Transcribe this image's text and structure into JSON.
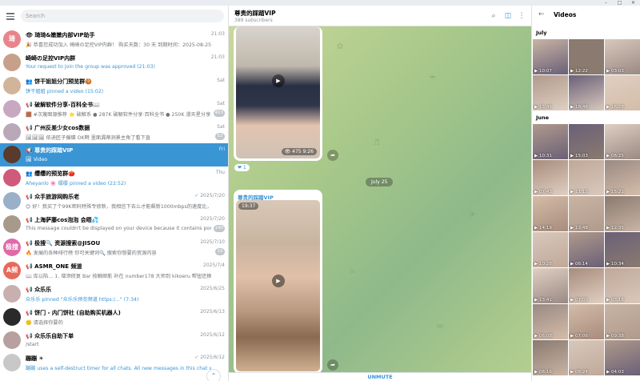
{
  "window": {
    "controls": [
      "–",
      "□",
      "✕"
    ]
  },
  "search": {
    "placeholder": "Search"
  },
  "chats": [
    {
      "name": "👁 琦琦&嫩嫩内部VIP助手",
      "time": "21:03",
      "preview": "🎉 恭喜您成功加入 崎崎の足控VIP内群！ 购买天数：30 天 到期时间：2025-08-25 21:03:53",
      "preview_style": "gray",
      "avatar_text": "琦",
      "avatar_color": "#e8848c",
      "badge": ""
    },
    {
      "name": "崎崎の足控VIP内群",
      "time": "21:03",
      "preview": "Your request to join the group was approved (21:03)",
      "preview_style": "blue",
      "avatar_text": "",
      "avatar_color": "#c7a08a",
      "badge": ""
    },
    {
      "name": "👥 饼干姐姐分门预览群🍪",
      "time": "Sat",
      "preview": "饼干姐姐 pinned a video (15:02)",
      "preview_style": "blue",
      "avatar_text": "",
      "avatar_color": "#d2b49a",
      "badge": ""
    },
    {
      "name": "📢 破解软件分享-百科全书📖",
      "time": "Sat",
      "preview": "🟫 #次蔑图源推荐 ⭐ 破解系 ● 287K 破解软件分享·百科全书 ● 250K 漫天星分享分...",
      "preview_style": "gray",
      "avatar_text": "",
      "avatar_color": "#c8a8c0",
      "badge": "403"
    },
    {
      "name": "📢 广州反差少女cos数据",
      "time": "Sat",
      "preview": "🖼🖼🖼 依迪匠子偏蝶 OK啊 里面漏蒂洞景主角了看下直",
      "preview_style": "gray",
      "avatar_text": "",
      "avatar_color": "#b8a8b8",
      "badge": "52"
    },
    {
      "name": "📢 尊贵的踩踏VIP",
      "time": "Fri",
      "preview": "🖼 Video",
      "preview_style": "gray",
      "avatar_text": "",
      "avatar_color": "#5a3a2a",
      "badge": "",
      "active": true
    },
    {
      "name": "👥 缨缨的预览群🍅",
      "time": "Thu",
      "preview": "Aheyanlo 🌸 缨缨 pinned a video (22:52)",
      "preview_style": "blue",
      "avatar_text": "",
      "avatar_color": "#d05a7a",
      "badge": ""
    },
    {
      "name": "📢 众手旅游网购乐老",
      "time": "✓ 2025/7/20",
      "preview": "😊 好！我买了个99K密码特殊专修新，我相信下去么才能飙新1000mbps的速度比，现在有我...",
      "preview_style": "gray",
      "avatar_text": "",
      "avatar_color": "#9ab0c8",
      "badge": ""
    },
    {
      "name": "📢 上海萨藤cos泡泡 会晤💦",
      "time": "2025/7/20",
      "preview": "This message couldn't be displayed on your device because it contains pornographic m...",
      "preview_style": "gray",
      "avatar_text": "",
      "avatar_color": "#a89a8a",
      "badge": "140"
    },
    {
      "name": "📢 极搜🔍 资源搜索@JISOU",
      "time": "2025/7/10",
      "preview": "🔥 发展的各种排行榜 你可关键词🔍 搜索你想要的资源内容",
      "preview_style": "gray",
      "avatar_text": "极搜",
      "avatar_color": "#e06aa8",
      "badge": "19"
    },
    {
      "name": "📢 ASMR_ONE 频道",
      "time": "2025/7/4",
      "preview": "📖 库以陷… 1. 增添修复 Bar 按触继能 补在 number178 大师到 kikoeru 帮钮还换数于。 指向...",
      "preview_style": "gray",
      "avatar_text": "A频",
      "avatar_color": "#e86a5a",
      "badge": ""
    },
    {
      "name": "📢 众乐乐",
      "time": "2025/6/25",
      "preview": "众乐乐 pinned \"众乐乐预览频道 https:/...\" (7:34)",
      "preview_style": "blue",
      "avatar_text": "",
      "avatar_color": "#c8b0b0",
      "badge": ""
    },
    {
      "name": "📢 饼门 - 内门饼社 (自助购买机器人)",
      "time": "2025/6/13",
      "preview": "🙂 请选择你要的",
      "preview_style": "gray",
      "avatar_text": "",
      "avatar_color": "#2a2a2a",
      "badge": ""
    },
    {
      "name": "📢 众乐乐自助下单",
      "time": "2025/6/12",
      "preview": "/start",
      "preview_style": "gray",
      "avatar_text": "",
      "avatar_color": "#b8a0a0",
      "badge": ""
    },
    {
      "name": "蹦蹦 ☀",
      "time": "✓ 2025/6/12",
      "preview": "蹦蹦 uses a self-destruct timer for all chats. All new messages in this chat will be automatically...",
      "preview_style": "blue",
      "avatar_text": "",
      "avatar_color": "#c8c8c8",
      "badge": ""
    }
  ],
  "channel": {
    "title": "尊贵的踩踏VIP",
    "subscribers": "389 subscribers",
    "date_separator": "July 25",
    "unmute_label": "UNMUTE",
    "msg1": {
      "views": "👁 475",
      "time": "9:26",
      "reaction": "❤ 1"
    },
    "msg2": {
      "sender": "尊贵的踩踏VIP",
      "duration": "19:37"
    }
  },
  "media_panel": {
    "title": "Videos",
    "months": [
      {
        "label": "July",
        "durations": [
          "10:07",
          "12:22",
          "03:03",
          "13:45",
          "18:48",
          "16:28"
        ]
      },
      {
        "label": "June",
        "durations": [
          "10:31",
          "15:03",
          "06:25",
          "07:43",
          "11:13",
          "15:21",
          "14:19",
          "13:48",
          "12:35",
          "10:28",
          "06:14",
          "10:34",
          "13:41",
          "07:00",
          "03:18",
          "06:08",
          "07:06",
          "09:38",
          "06:16",
          "06:24",
          "04:03"
        ]
      }
    ]
  }
}
